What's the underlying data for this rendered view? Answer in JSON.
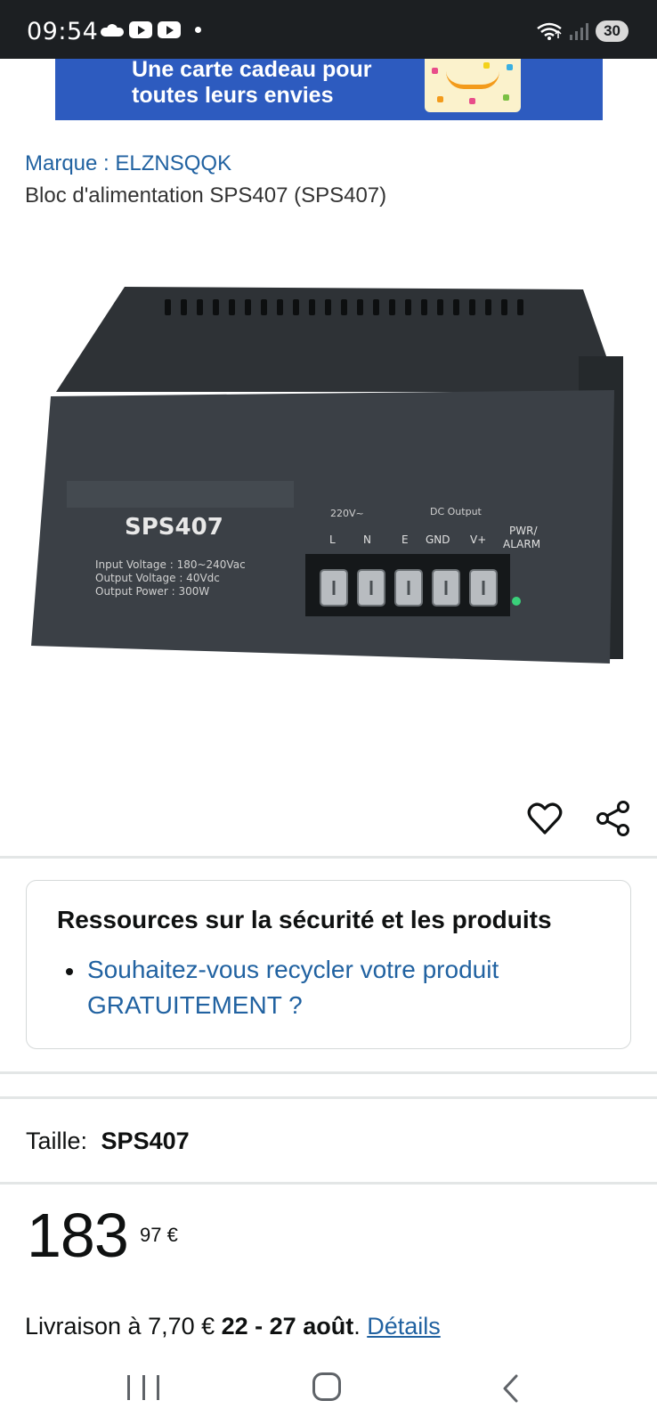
{
  "status_bar": {
    "time": "09:54",
    "battery": "30",
    "icons": [
      "cloud-icon",
      "youtube-icon",
      "youtube-icon",
      "notification-dot",
      "wifi-icon",
      "signal-icon",
      "battery-icon"
    ]
  },
  "banner": {
    "line1": "Une carte cadeau pour",
    "line2": "toutes leurs envies"
  },
  "product": {
    "brand": "Marque : ELZNSQQK",
    "title": "Bloc d'alimentation SPS407 (SPS407)",
    "image": {
      "model": "SPS407",
      "spec_input": "Input   Voltage : 180~240Vac",
      "spec_output_voltage": "Output  Voltage : 40Vdc",
      "spec_output_power": "Output  Power : 300W",
      "ac_label": "220V~",
      "dc_label": "DC Output",
      "terminals": [
        "L",
        "N",
        "E",
        "GND",
        "V+"
      ],
      "led_label_1": "PWR/",
      "led_label_2": "ALARM"
    }
  },
  "actions": {
    "favorite_icon": "heart-icon",
    "share_icon": "share-icon"
  },
  "safety": {
    "title": "Ressources sur la sécurité et les produits",
    "link": "Souhaitez-vous recycler votre produit GRATUITEMENT ?"
  },
  "size": {
    "label": "Taille:",
    "value": "SPS407"
  },
  "price": {
    "whole": "183",
    "fraction": "97 €"
  },
  "delivery": {
    "prefix": "Livraison à 7,70 € ",
    "dates": "22 - 27 août",
    "dot": ". ",
    "link": "Détails"
  },
  "nav": {
    "icons": [
      "recent-apps-icon",
      "home-icon",
      "back-icon"
    ]
  },
  "colors": {
    "link": "#2162a1",
    "banner": "#2d5bbf",
    "status_bar": "#1c1f22"
  }
}
